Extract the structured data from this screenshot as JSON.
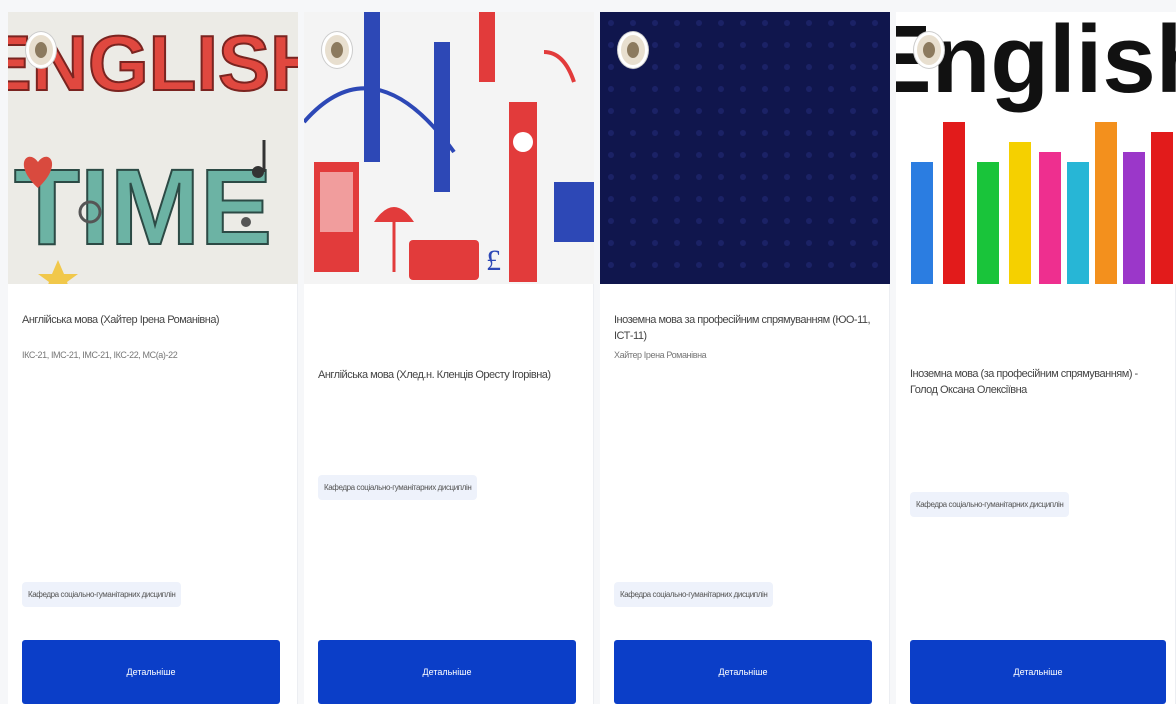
{
  "cards": [
    {
      "title": "Англійська мова (Хайтер Ірена Романівна)",
      "subtitle": "ІКС-21, ІМС-21, ІМС-21, ІКС-22, МС(а)-22",
      "department": "Кафедра соціально-гуманітарних дисциплін",
      "button": "Детальніше",
      "image_text": [
        "ENGLISH",
        "TIME"
      ]
    },
    {
      "title": "Англійська мова (Хлед.н. Кленців Оресту Ігорівна)",
      "subtitle": "",
      "department": "Кафедра соціально-гуманітарних дисциплін",
      "button": "Детальніше"
    },
    {
      "title": "Іноземна мова за професійним спрямуванням (ЮО-11, ІСТ-11)",
      "subtitle": "Хайтер Ірена Романівна",
      "department": "Кафедра соціально-гуманітарних дисциплін",
      "button": "Детальніше"
    },
    {
      "title": "Іноземна мова (за професійним спрямуванням) - Голод Оксана Олексіївна",
      "subtitle": "",
      "department": "Кафедра соціально-гуманітарних дисциплін",
      "button": "Детальніше",
      "image_text": [
        "English"
      ]
    }
  ],
  "colors": {
    "button": "#0b3ec8",
    "navy_banner": "#10164d",
    "tag_bg": "#eef2fb"
  }
}
